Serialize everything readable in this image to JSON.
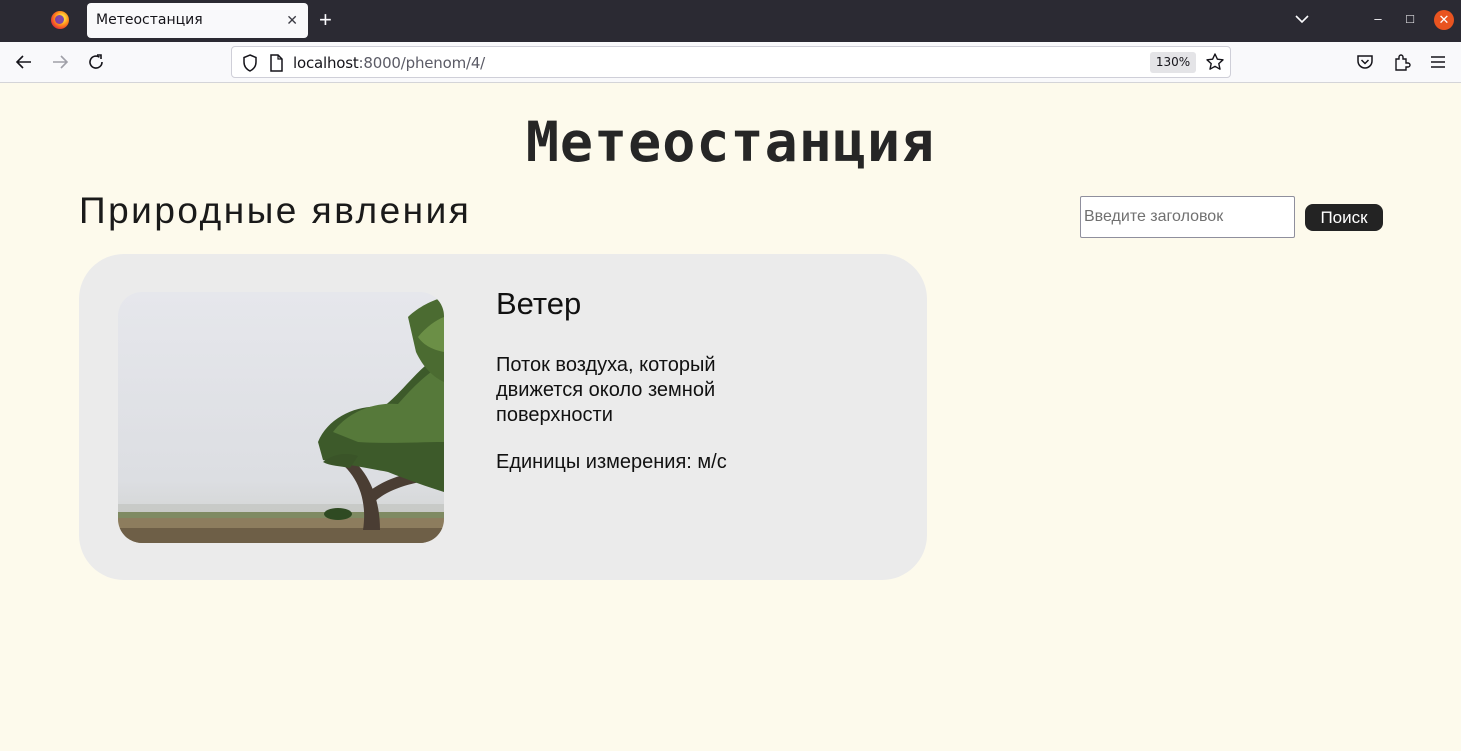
{
  "browser": {
    "tab_title": "Метеостанция",
    "tab_close": "✕",
    "new_tab": "+",
    "url_host": "localhost",
    "url_rest": ":8000/phenom/4/",
    "zoom": "130%",
    "minimize": "–",
    "maximize": "□",
    "close": "✕"
  },
  "page": {
    "site_title": "Метеостанция",
    "section_title": "Природные явления",
    "search": {
      "placeholder": "Введите заголовок",
      "button": "Поиск"
    },
    "card": {
      "title": "Ветер",
      "description": "Поток воздуха, который движется около земной поверхности",
      "units": "Единицы измерения: м/с",
      "image": "wind-tree-photo"
    }
  },
  "colors": {
    "page_background": "#fdfaec",
    "card_background": "#ebebeb",
    "button_background": "#232323"
  }
}
